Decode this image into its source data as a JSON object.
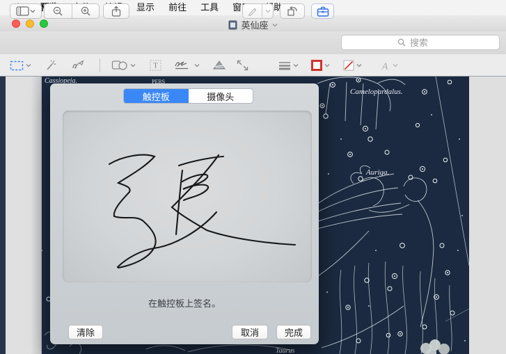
{
  "menubar": {
    "apple_icon": "apple-logo",
    "items": [
      "预览",
      "文件",
      "编辑",
      "显示",
      "前往",
      "工具",
      "窗口",
      "帮助"
    ]
  },
  "window": {
    "title": "英仙座"
  },
  "toolbar": {
    "search_placeholder": "搜索",
    "icons": [
      "sidebar-view-icon",
      "zoom-out-icon",
      "zoom-in-icon",
      "share-icon",
      "marker-pen-icon",
      "rotate-left-icon",
      "markup-toolbox-icon",
      "search-icon"
    ]
  },
  "markup_toolbar": {
    "icons": [
      "selection-rect-icon",
      "magic-wand-icon",
      "sketch-icon",
      "shapes-icon",
      "text-tool-icon",
      "signature-icon",
      "adjust-color-icon",
      "adjust-size-icon",
      "line-style-icon",
      "border-color-icon",
      "fill-color-icon",
      "text-style-icon"
    ]
  },
  "dialog": {
    "tabs": {
      "trackpad": "触控板",
      "camera": "摄像头"
    },
    "caption": "在触控板上签名。",
    "buttons": {
      "clear": "清除",
      "cancel": "取消",
      "done": "完成"
    },
    "signature_character": "張"
  },
  "map": {
    "labels": {
      "cassiopeia": "Cassiopeja.",
      "perseus_fragment": "PERS",
      "camelopardalis": "Camelopardalus.",
      "auriga": "Auriga.",
      "taurus": "Taurus"
    }
  },
  "colors": {
    "accent_blue": "#3a87f7",
    "map_navy": "#1b2a40",
    "marker_red": "#cf342c"
  }
}
